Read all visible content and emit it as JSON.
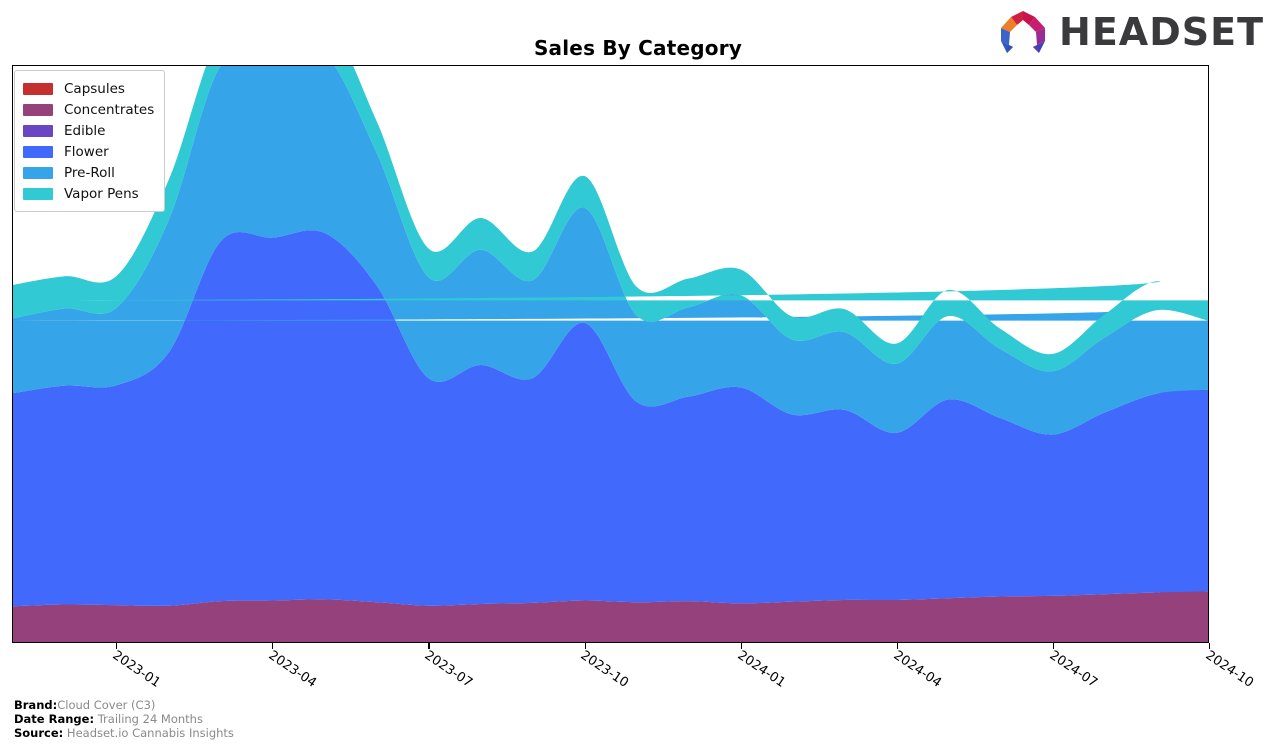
{
  "header": {
    "title": "Sales By Category",
    "logo_text": "HEADSET",
    "logo_icon": "headset-arch-logo"
  },
  "footer": {
    "brand_label": "Brand:",
    "brand_value": "Cloud Cover (C3)",
    "date_range_label": "Date Range:",
    "date_range_value": "Trailing 24 Months",
    "source_label": "Source:",
    "source_value": "Headset.io Cannabis Insights"
  },
  "legend": {
    "items": [
      {
        "label": "Capsules",
        "color": "#c62f2f"
      },
      {
        "label": "Concentrates",
        "color": "#94417c"
      },
      {
        "label": "Edible",
        "color": "#6a45c4"
      },
      {
        "label": "Flower",
        "color": "#4169fb"
      },
      {
        "label": "Pre-Roll",
        "color": "#36a4e8"
      },
      {
        "label": "Vapor Pens",
        "color": "#31c9d4"
      }
    ]
  },
  "chart_data": {
    "type": "area",
    "stacked": true,
    "title": "Sales By Category",
    "xlabel": "",
    "ylabel": "",
    "grid": false,
    "legend_position": "top-left",
    "smoothing": "spline",
    "x": [
      "2022-11",
      "2022-12",
      "2023-01",
      "2023-02",
      "2023-03",
      "2023-04",
      "2023-05",
      "2023-06",
      "2023-07",
      "2023-08",
      "2023-09",
      "2023-10",
      "2023-11",
      "2023-12",
      "2024-01",
      "2024-02",
      "2024-03",
      "2024-04",
      "2024-05",
      "2024-06",
      "2024-07",
      "2024-08",
      "2024-09",
      "2024-10"
    ],
    "tick_labels": [
      "2023-01",
      "2023-04",
      "2023-07",
      "2023-10",
      "2024-01",
      "2024-04",
      "2024-07",
      "2024-10"
    ],
    "tick_x": [
      "2023-01",
      "2023-04",
      "2023-07",
      "2023-10",
      "2024-01",
      "2024-04",
      "2024-07",
      "2024-10"
    ],
    "ylim": [
      0,
      100
    ],
    "series": [
      {
        "name": "Capsules",
        "color": "#c62f2f",
        "values": [
          0,
          0,
          0,
          0,
          0,
          0,
          0,
          0,
          0,
          0,
          0,
          0,
          0,
          0,
          0,
          0,
          0,
          0,
          0,
          0,
          0,
          0,
          0,
          0
        ]
      },
      {
        "name": "Concentrates",
        "color": "#94417c",
        "values": [
          6.2,
          6.5,
          6.4,
          6.3,
          7.1,
          7.2,
          7.4,
          6.9,
          6.3,
          6.6,
          6.8,
          7.2,
          6.9,
          7.1,
          6.7,
          7.0,
          7.3,
          7.3,
          7.6,
          7.9,
          8.0,
          8.3,
          8.6,
          8.8
        ]
      },
      {
        "name": "Edible",
        "color": "#6a45c4",
        "values": [
          0,
          0,
          0,
          0,
          0,
          0,
          0,
          0,
          0,
          0,
          0,
          0,
          0,
          0,
          0,
          0,
          0,
          0,
          0,
          0,
          0,
          0,
          0,
          0
        ]
      },
      {
        "name": "Flower",
        "color": "#4169fb",
        "values": [
          37.0,
          38.0,
          38.2,
          44.0,
          62.5,
          63.0,
          63.6,
          55.0,
          39.5,
          41.5,
          39.0,
          48.2,
          34.8,
          35.5,
          37.5,
          32.5,
          33.0,
          29.0,
          34.5,
          31.0,
          28.0,
          31.5,
          34.5,
          35.0
        ]
      },
      {
        "name": "Pre-Roll",
        "color": "#36a4e8",
        "values": [
          13.0,
          13.4,
          13.5,
          23.0,
          30.5,
          30.0,
          31.0,
          23.0,
          17.5,
          20.0,
          17.0,
          20.0,
          15.0,
          15.5,
          16.0,
          13.0,
          13.5,
          12.0,
          14.5,
          12.0,
          11.0,
          13.0,
          14.5,
          12.0
        ]
      },
      {
        "name": "Vapor Pens",
        "color": "#31c9d4",
        "values": [
          5.8,
          5.6,
          5.5,
          7.0,
          5.5,
          5.5,
          6.5,
          5.5,
          5.0,
          5.5,
          5.0,
          5.5,
          5.0,
          5.0,
          4.5,
          4.0,
          4.0,
          3.5,
          4.5,
          3.5,
          3.0,
          4.0,
          5.0,
          3.5
        ]
      }
    ]
  }
}
